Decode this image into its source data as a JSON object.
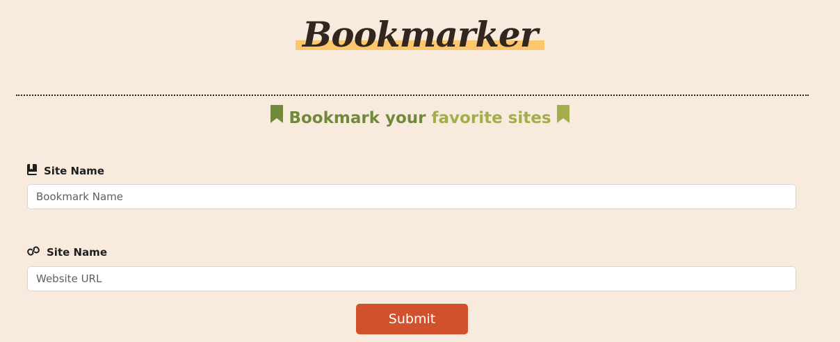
{
  "header": {
    "logo_text": "Bookmarker",
    "subtitle_text_part1": "Bookmark your ",
    "subtitle_text_part2": "favorite sites",
    "highlight_color": "#fcc76c"
  },
  "form": {
    "site_name": {
      "label": "Site Name",
      "placeholder": "Bookmark Name",
      "value": "",
      "icon": "book-icon"
    },
    "site_url": {
      "label": "Site Name",
      "placeholder": "Website URL",
      "value": "",
      "icon": "link-icon"
    },
    "submit_label": "Submit"
  },
  "colors": {
    "background": "#f8ebde",
    "accent_green_dark": "#6f8a3b",
    "accent_green_light": "#a2ad4c",
    "submit": "#d2512d"
  }
}
